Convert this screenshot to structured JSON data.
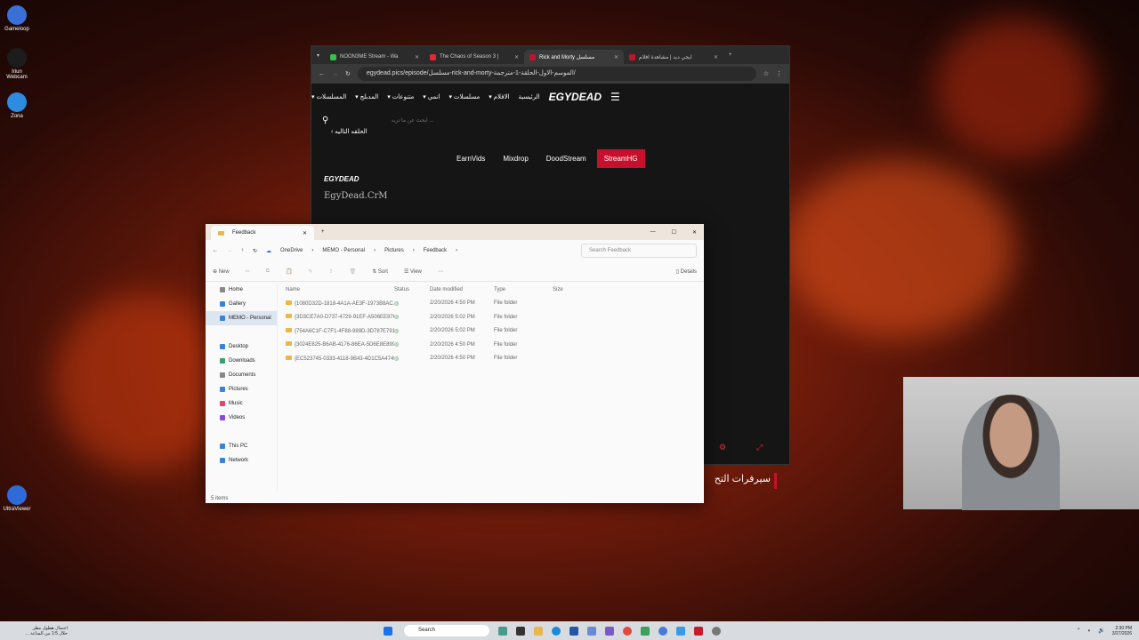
{
  "desktop": {
    "icons": [
      {
        "label": "Gameloop",
        "color": "#3a6fd8"
      },
      {
        "label": "Iriun Webcam",
        "color": "#1c1c1c"
      },
      {
        "label": "Zona",
        "color": "#2d8ce0"
      },
      {
        "label": "UltraViewer",
        "color": "#2f6ad8"
      }
    ]
  },
  "browser": {
    "tabs": [
      {
        "label": "NOON3ME Stream - Wa",
        "color": "#39c24a"
      },
      {
        "label": "The Chaos of Season 3 |",
        "color": "#e0283a"
      },
      {
        "label": "Rick and Morty مسلسل",
        "color": "#c8102e"
      },
      {
        "label": "ايجي ديد | مشاهدة افلام",
        "color": "#c8102e"
      }
    ],
    "url": "egydead.pics/episode/مسلسل-rick-and-morty-الموسم-الاول-الحلقة-1-مترجمة/",
    "nav": [
      "الرئيسية",
      "الافلام",
      "مسلسلات",
      "انمي",
      "متنوعات",
      "المدبلج",
      "المسلسلات"
    ],
    "logo": "EGYDEAD",
    "search_placeholder": "ابحث عن ما تريد ...",
    "next_episode": "الحلقه التاليه",
    "servers": [
      "EarnVids",
      "Mixdrop",
      "DoodStream",
      "StreamHG"
    ],
    "active_server": "StreamHG",
    "player_logo": "EGYDEAD",
    "watermark": "EgyDead.CrM",
    "servers_heading": "سيرفرات التح"
  },
  "explorer": {
    "tab_title": "Feedback",
    "breadcrumbs": [
      "OneDrive",
      "MEMO - Personal",
      "Pictures",
      "Feedback"
    ],
    "search_placeholder": "Search Feedback",
    "toolbar": {
      "new": "New",
      "sort": "Sort",
      "view": "View",
      "details": "Details"
    },
    "nav": [
      {
        "label": "Home",
        "color": "#888"
      },
      {
        "label": "Gallery",
        "color": "#3a82d8"
      },
      {
        "label": "MEMO - Personal",
        "color": "#3a82d8",
        "selected": true
      },
      {
        "label": "Desktop",
        "color": "#3a82d8"
      },
      {
        "label": "Downloads",
        "color": "#3aa06a"
      },
      {
        "label": "Documents",
        "color": "#888"
      },
      {
        "label": "Pictures",
        "color": "#3a82d8"
      },
      {
        "label": "Music",
        "color": "#e04a6a"
      },
      {
        "label": "Videos",
        "color": "#8a4ad8"
      },
      {
        "label": "This PC",
        "color": "#3a82d8"
      },
      {
        "label": "Network",
        "color": "#3a82d8"
      }
    ],
    "columns": [
      "Name",
      "Status",
      "Date modified",
      "Type",
      "Size"
    ],
    "rows": [
      {
        "name": "{1080D32D-1818-4A1A-AE3F-1973B8AC...",
        "date": "2/20/2026 4:50 PM",
        "type": "File folder"
      },
      {
        "name": "{3D3CE7A0-D737-4729-91EF-A506EE876B...",
        "date": "2/20/2026 5:02 PM",
        "type": "File folder"
      },
      {
        "name": "{754A6C1F-C7F1-4F88-989D-3D787E791A...",
        "date": "2/20/2026 5:02 PM",
        "type": "File folder"
      },
      {
        "name": "{3024E825-B6AB-4176-86EA-5D6E8E8992...",
        "date": "2/20/2026 4:50 PM",
        "type": "File folder"
      },
      {
        "name": "{EC523745-0333-4118-9B43-4D1C5A4745...",
        "date": "2/20/2026 4:50 PM",
        "type": "File folder"
      }
    ],
    "item_count": "5 items"
  },
  "taskbar": {
    "search": "Search",
    "time": "2:30 PM",
    "date": "3/27/2026",
    "weather_line1": "احتمال هطول مطر",
    "weather_line2": "خلال 1:5 من الساعة ..."
  }
}
